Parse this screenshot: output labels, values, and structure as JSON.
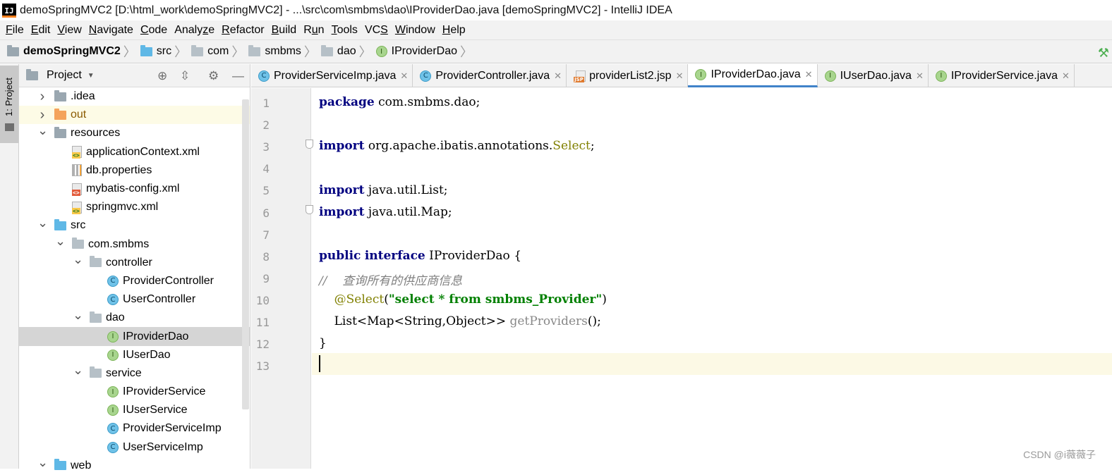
{
  "window": {
    "title": "demoSpringMVC2 [D:\\html_work\\demoSpringMVC2] - ...\\src\\com\\smbms\\dao\\IProviderDao.java [demoSpringMVC2] - IntelliJ IDEA",
    "logo_text": "IJ"
  },
  "menu": [
    {
      "m": "F",
      "rest": "ile"
    },
    {
      "m": "E",
      "rest": "dit"
    },
    {
      "m": "V",
      "rest": "iew"
    },
    {
      "m": "N",
      "rest": "avigate"
    },
    {
      "m": "C",
      "rest": "ode"
    },
    {
      "pre": "Analy",
      "m": "z",
      "rest": "e"
    },
    {
      "m": "R",
      "rest": "efactor"
    },
    {
      "m": "B",
      "rest": "uild"
    },
    {
      "pre": "R",
      "m": "u",
      "rest": "n"
    },
    {
      "m": "T",
      "rest": "ools"
    },
    {
      "pre": "VC",
      "m": "S",
      "rest": ""
    },
    {
      "m": "W",
      "rest": "indow"
    },
    {
      "m": "H",
      "rest": "elp"
    }
  ],
  "breadcrumb": [
    "demoSpringMVC2",
    "src",
    "com",
    "smbms",
    "dao",
    "IProviderDao"
  ],
  "project_panel": {
    "title": "Project",
    "tool_window_label": "1: Project",
    "tree": [
      {
        "label": ".idea",
        "depth": 0,
        "arrow": "right",
        "icon": "folder-grey"
      },
      {
        "label": "out",
        "depth": 0,
        "arrow": "right",
        "icon": "folder-orange"
      },
      {
        "label": "resources",
        "depth": 0,
        "arrow": "down",
        "icon": "folder-grey"
      },
      {
        "label": "applicationContext.xml",
        "depth": 1,
        "arrow": "",
        "icon": "xml-file"
      },
      {
        "label": "db.properties",
        "depth": 1,
        "arrow": "",
        "icon": "properties-file"
      },
      {
        "label": "mybatis-config.xml",
        "depth": 1,
        "arrow": "",
        "icon": "mybatis-file"
      },
      {
        "label": "springmvc.xml",
        "depth": 1,
        "arrow": "",
        "icon": "xml-file"
      },
      {
        "label": "src",
        "depth": 0,
        "arrow": "down",
        "icon": "folder-blue"
      },
      {
        "label": "com.smbms",
        "depth": 1,
        "arrow": "down",
        "icon": "package"
      },
      {
        "label": "controller",
        "depth": 2,
        "arrow": "down",
        "icon": "package"
      },
      {
        "label": "ProviderController",
        "depth": 3,
        "arrow": "",
        "icon": "class"
      },
      {
        "label": "UserController",
        "depth": 3,
        "arrow": "",
        "icon": "class"
      },
      {
        "label": "dao",
        "depth": 2,
        "arrow": "down",
        "icon": "package"
      },
      {
        "label": "IProviderDao",
        "depth": 3,
        "arrow": "",
        "icon": "interface"
      },
      {
        "label": "IUserDao",
        "depth": 3,
        "arrow": "",
        "icon": "interface"
      },
      {
        "label": "service",
        "depth": 2,
        "arrow": "down",
        "icon": "package"
      },
      {
        "label": "IProviderService",
        "depth": 3,
        "arrow": "",
        "icon": "interface"
      },
      {
        "label": "IUserService",
        "depth": 3,
        "arrow": "",
        "icon": "interface"
      },
      {
        "label": "ProviderServiceImp",
        "depth": 3,
        "arrow": "",
        "icon": "class"
      },
      {
        "label": "UserServiceImp",
        "depth": 3,
        "arrow": "",
        "icon": "class"
      },
      {
        "label": "web",
        "depth": 0,
        "arrow": "down",
        "icon": "folder-blue"
      }
    ],
    "selected": "IProviderDao",
    "highlighted": "out"
  },
  "tabs": [
    {
      "label": "ProviderServiceImp.java",
      "icon": "class",
      "active": false
    },
    {
      "label": "ProviderController.java",
      "icon": "class",
      "active": false
    },
    {
      "label": "providerList2.jsp",
      "icon": "jsp",
      "active": false
    },
    {
      "label": "IProviderDao.java",
      "icon": "interface",
      "active": true
    },
    {
      "label": "IUserDao.java",
      "icon": "interface",
      "active": false
    },
    {
      "label": "IProviderService.java",
      "icon": "interface",
      "active": false
    }
  ],
  "editor": {
    "line_numbers": [
      "1",
      "2",
      "3",
      "4",
      "5",
      "6",
      "7",
      "8",
      "9",
      "10",
      "11",
      "12",
      "13"
    ],
    "current_line": "13",
    "code": {
      "l1_kw": "package",
      "l1_rest": " com.smbms.dao;",
      "l3_kw": "import",
      "l3_rest": " org.apache.ibatis.annotations.",
      "l3_ann": "Select",
      "l3_end": ";",
      "l5_kw": "import",
      "l5_rest": " java.util.List;",
      "l6_kw": "import",
      "l6_rest": " java.util.Map;",
      "l8_kw1": "public",
      "l8_kw2": "interface",
      "l8_rest": " IProviderDao {",
      "l9_comment": "//    查询所有的供应商信息",
      "l10_indent": "    ",
      "l10_ann": "@Select",
      "l10_open": "(",
      "l10_str": "\"select * from smbms_Provider\"",
      "l10_close": ")",
      "l11_code": "    List<Map<String,Object>> ",
      "l11_method": "getProviders",
      "l11_end": "();",
      "l12_code": "}"
    }
  },
  "watermark": "CSDN @i薇薇子"
}
